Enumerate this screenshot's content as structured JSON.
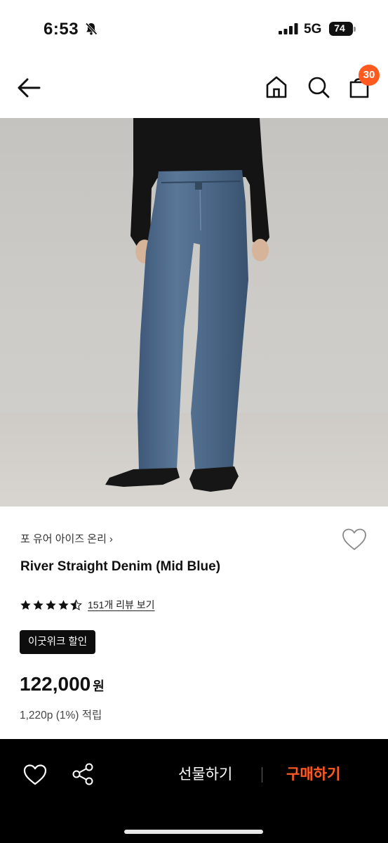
{
  "status_bar": {
    "time": "6:53",
    "network": "5G",
    "battery": "74"
  },
  "header": {
    "cart_count": "30"
  },
  "product": {
    "brand": "포 유어 아이즈 온리",
    "brand_chevron": "›",
    "name": "River Straight Denim (Mid Blue)",
    "rating": 4.5,
    "review_link": "151개 리뷰 보기",
    "promo_badge": "이굿위크 할인",
    "price": "122,000",
    "currency": "원",
    "points": "1,220p (1%) 적립"
  },
  "bottom_bar": {
    "gift_label": "선물하기",
    "buy_label": "구매하기"
  },
  "icons": {
    "status": [
      "bell-off-icon",
      "signal-icon",
      "battery-icon"
    ],
    "header": [
      "back-arrow-icon",
      "home-icon",
      "search-icon",
      "cart-icon"
    ],
    "info": [
      "heart-icon",
      "star-icon"
    ],
    "bottom": [
      "heart-icon",
      "share-icon"
    ]
  },
  "colors": {
    "accent": "#ff5a1f",
    "bottom_bar_bg": "#000000",
    "promo_bg": "#0d0d0d"
  }
}
